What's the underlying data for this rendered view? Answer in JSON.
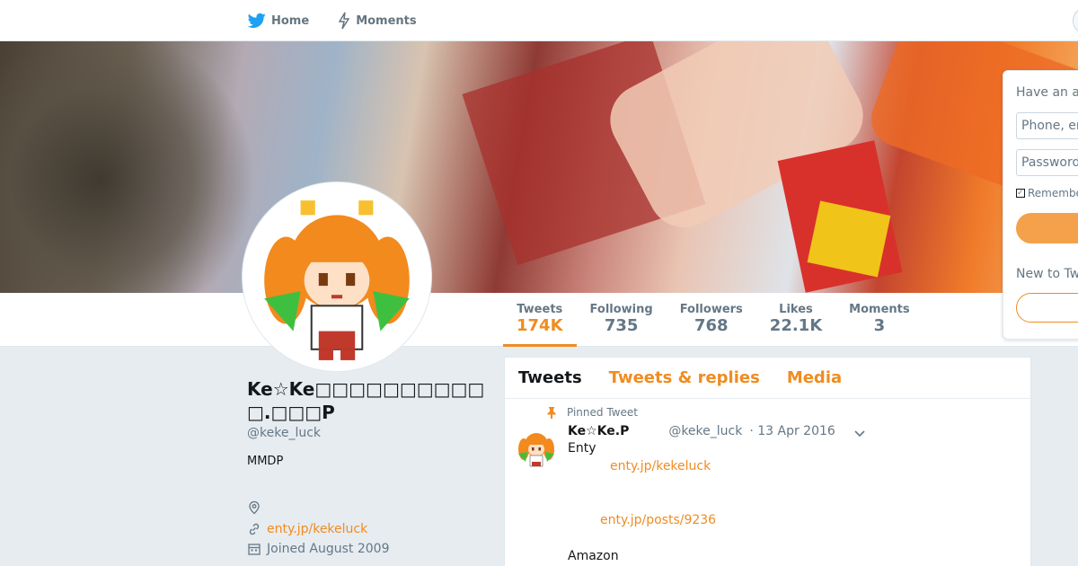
{
  "colors": {
    "accent": "#f08c21",
    "twitter_blue": "#1da1f2",
    "muted": "#657786",
    "background": "#e6ecf0"
  },
  "nav": {
    "home_label": "Home",
    "home_icon": "twitter-bird-icon",
    "moments_label": "Moments",
    "moments_icon": "lightning-icon"
  },
  "stats": [
    {
      "label": "Tweets",
      "value": "174K"
    },
    {
      "label": "Following",
      "value": "735"
    },
    {
      "label": "Followers",
      "value": "768"
    },
    {
      "label": "Likes",
      "value": "22.1K"
    },
    {
      "label": "Moments",
      "value": "3"
    }
  ],
  "profile": {
    "name": "Ke☆Ke□□□□□□□□□□□.□□□P",
    "handle": "@keke_luck",
    "bio": "MMDP",
    "location_icon": "location-pin-icon",
    "url_icon": "link-icon",
    "url": "enty.jp/kekeluck",
    "calendar_icon": "calendar-icon",
    "joined": "Joined August 2009"
  },
  "timeline": {
    "tabs": [
      "Tweets",
      "Tweets & replies",
      "Media"
    ],
    "pinned_label": "Pinned Tweet",
    "tweet": {
      "name": "Ke☆Ke.P",
      "handle": "@keke_luck",
      "date": "· 13 Apr 2016",
      "lines": [
        "Enty",
        "enty.jp/kekeluck",
        "enty.jp/posts/9236",
        "Amazon"
      ]
    }
  },
  "login": {
    "title": "Have an account?",
    "phone_placeholder": "Phone, email or username",
    "password_placeholder": "Password",
    "remember_label": "Remember me",
    "new_label": "New to Twitter?"
  }
}
